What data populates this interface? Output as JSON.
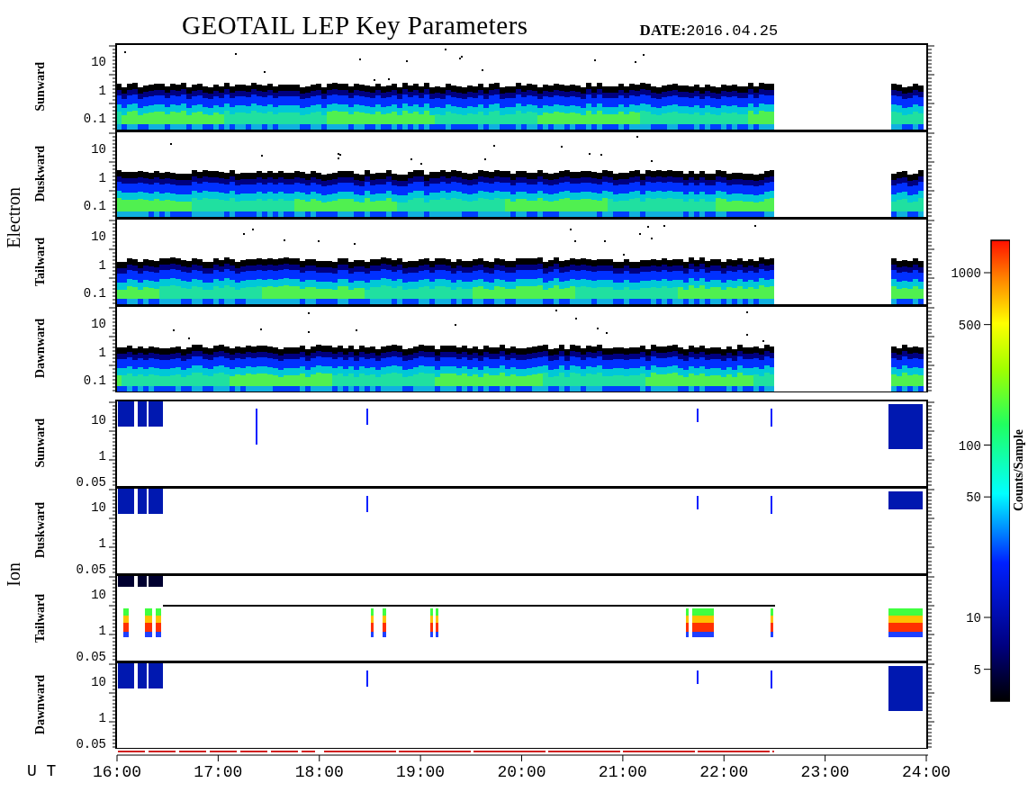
{
  "title": "GEOTAIL LEP Key Parameters",
  "date": {
    "label": "DATE:",
    "value": "2016.04.25"
  },
  "groups": [
    {
      "name": "Electron",
      "kind": "electron",
      "panels": [
        {
          "label": "Sunward",
          "yticks": [
            "10",
            "1",
            "0.1"
          ]
        },
        {
          "label": "Duskward",
          "yticks": [
            "10",
            "1",
            "0.1"
          ]
        },
        {
          "label": "Tailward",
          "yticks": [
            "10",
            "1",
            "0.1"
          ]
        },
        {
          "label": "Dawnward",
          "yticks": [
            "10",
            "1",
            "0.1"
          ]
        }
      ]
    },
    {
      "name": "Ion",
      "kind": "ion",
      "panels": [
        {
          "label": "Sunward",
          "yticks": [
            "10",
            "1",
            "0.05"
          ]
        },
        {
          "label": "Duskward",
          "yticks": [
            "10",
            "1",
            "0.05"
          ]
        },
        {
          "label": "Tailward",
          "yticks": [
            "10",
            "1",
            "0.05"
          ]
        },
        {
          "label": "Dawnward",
          "yticks": [
            "10",
            "1",
            "0.05"
          ]
        }
      ]
    }
  ],
  "colorbar": {
    "title": "Counts/Sample",
    "ticks": [
      "1000",
      "500",
      "100",
      "50",
      "10",
      "5"
    ]
  },
  "time_axis": {
    "label": "U T",
    "ticks": [
      "16:00",
      "17:00",
      "18:00",
      "19:00",
      "20:00",
      "21:00",
      "22:00",
      "23:00",
      "24:00"
    ]
  }
}
